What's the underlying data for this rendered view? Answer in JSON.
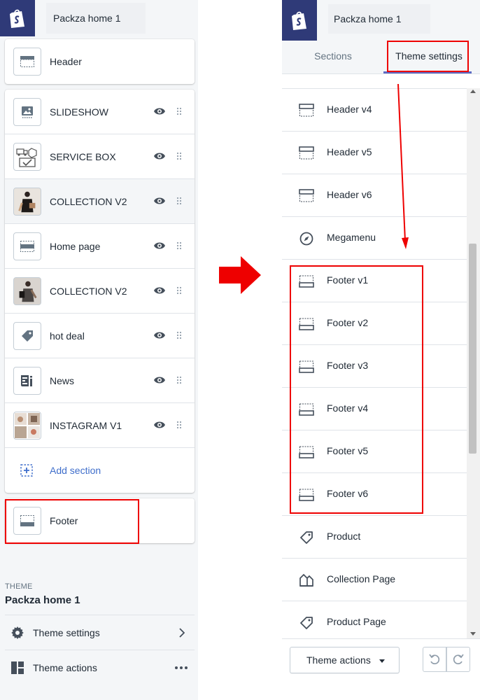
{
  "store_name": "Packza home 1",
  "left": {
    "header_section": {
      "label": "Header",
      "icon": "header-layout-icon"
    },
    "sections": [
      {
        "label": "SLIDESHOW",
        "icon": "image-icon"
      },
      {
        "label": "SERVICE BOX",
        "icon": "service-box-thumbnail"
      },
      {
        "label": "COLLECTION V2",
        "icon": "collection-photo-thumbnail"
      },
      {
        "label": "Home page",
        "icon": "layout-icon"
      },
      {
        "label": "COLLECTION V2",
        "icon": "collection-photo-thumbnail"
      },
      {
        "label": "hot deal",
        "icon": "tag-icon"
      },
      {
        "label": "News",
        "icon": "blog-icon"
      },
      {
        "label": "INSTAGRAM V1",
        "icon": "instagram-grid-thumbnail"
      }
    ],
    "add_section": "Add section",
    "footer_section": {
      "label": "Footer",
      "icon": "footer-layout-icon"
    },
    "theme_caption": "THEME",
    "theme_name": "Packza home 1",
    "theme_settings": "Theme settings",
    "theme_actions": "Theme actions"
  },
  "right": {
    "tabs": {
      "sections": "Sections",
      "theme_settings": "Theme settings"
    },
    "items": [
      {
        "label": "Header v4",
        "icon": "header-layout-icon"
      },
      {
        "label": "Header v5",
        "icon": "header-layout-icon"
      },
      {
        "label": "Header v6",
        "icon": "header-layout-icon"
      },
      {
        "label": "Megamenu",
        "icon": "compass-icon"
      },
      {
        "label": "Footer v1",
        "icon": "footer-layout-icon"
      },
      {
        "label": "Footer v2",
        "icon": "footer-layout-icon"
      },
      {
        "label": "Footer v3",
        "icon": "footer-layout-icon"
      },
      {
        "label": "Footer v4",
        "icon": "footer-layout-icon"
      },
      {
        "label": "Footer v5",
        "icon": "footer-layout-icon"
      },
      {
        "label": "Footer v6",
        "icon": "footer-layout-icon"
      },
      {
        "label": "Product",
        "icon": "tag-icon"
      },
      {
        "label": "Collection Page",
        "icon": "collection-icon"
      },
      {
        "label": "Product Page",
        "icon": "tag-icon"
      }
    ],
    "theme_actions": "Theme actions"
  },
  "colors": {
    "brand_dark": "#2f3a78",
    "highlight_red": "#ee0000",
    "link_blue": "#3f6ecb",
    "tab_underline": "#5c6ac4"
  }
}
